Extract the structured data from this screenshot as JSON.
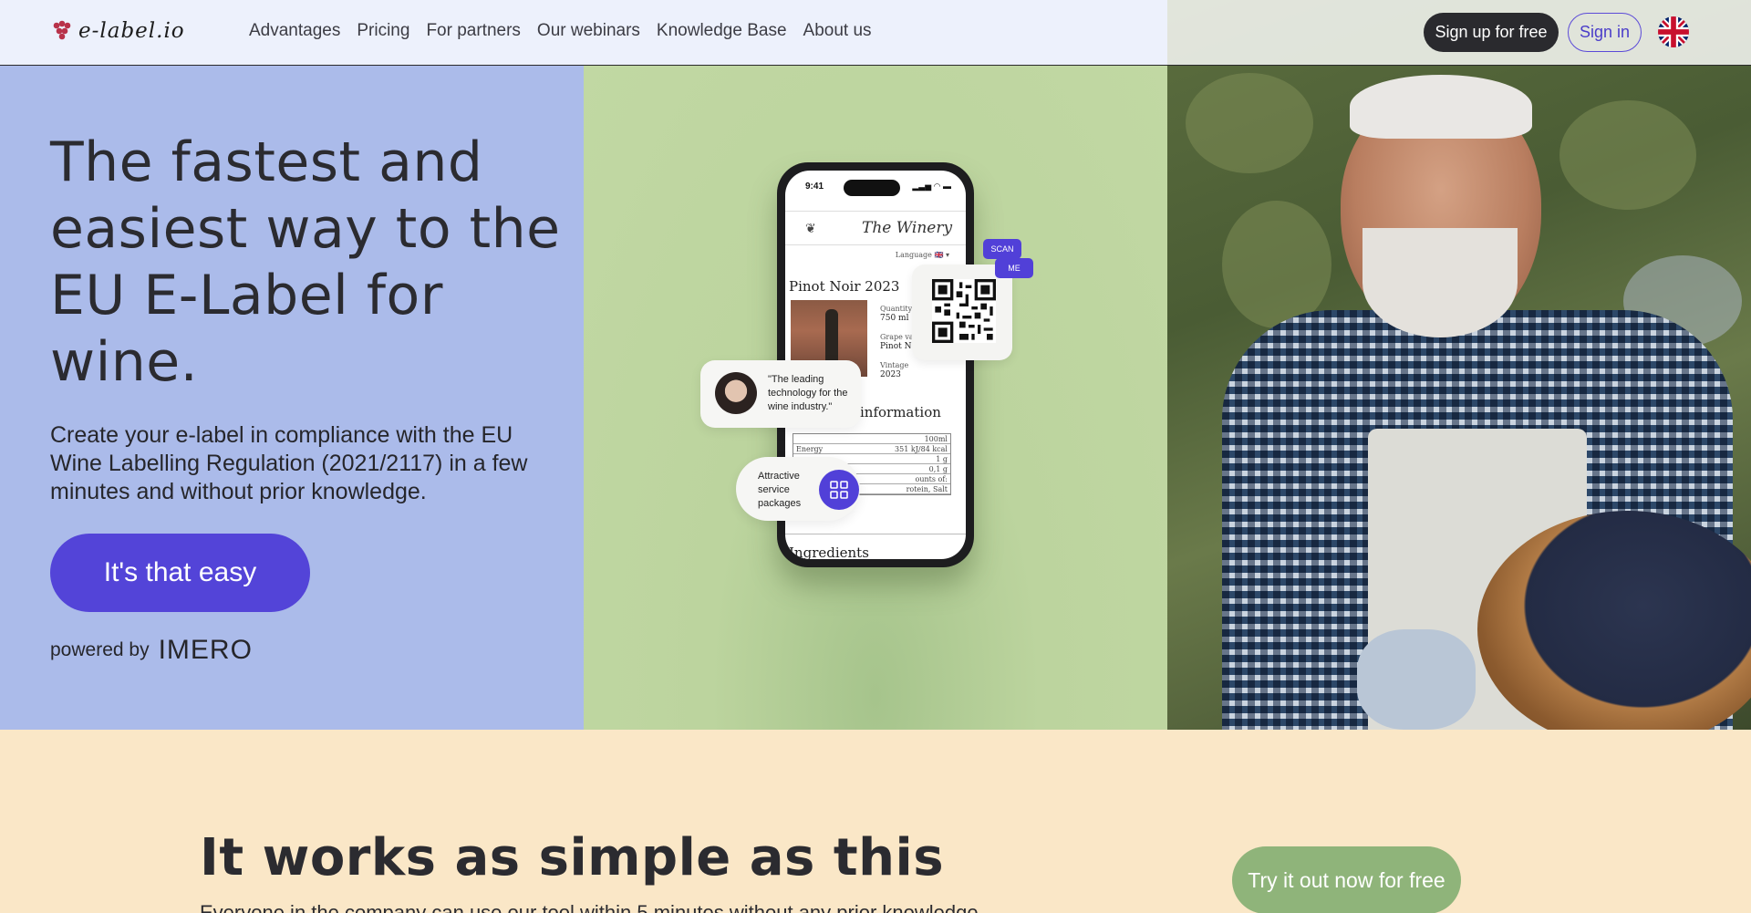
{
  "header": {
    "logo_text": "e-label.io",
    "nav": [
      "Advantages",
      "Pricing",
      "For partners",
      "Our webinars",
      "Knowledge Base",
      "About us"
    ],
    "signup_label": "Sign up for free",
    "signin_label": "Sign in",
    "language_icon": "uk-flag-icon"
  },
  "hero": {
    "title": "The fastest and easiest way to the EU E-Label for wine.",
    "subtitle": "Create your e-label in compliance with the EU Wine Labelling Regulation (2021/2117) in a few minutes and without prior knowledge.",
    "cta_label": "It's that easy",
    "powered_by_label": "powered by",
    "powered_by_brand": "IMERO"
  },
  "phone": {
    "time": "9:41",
    "status": "▂▃▅ ◠ ▬",
    "winery": "The Winery",
    "language_label": "Language",
    "language_flag": "🇬🇧 ▾",
    "product": "Pinot Noir 2023",
    "meta": [
      {
        "label": "Quantity",
        "value": "750 ml"
      },
      {
        "label": "Grape var",
        "value": "Pinot No"
      },
      {
        "label": "Vintage",
        "value": "2023"
      }
    ],
    "info_heading": "information",
    "table_header": "100ml",
    "table_rows": [
      {
        "label": "Energy",
        "value": "351 kJ/84 kcal"
      },
      {
        "label": "",
        "value": "1 g"
      },
      {
        "label": "",
        "value": "0,1 g"
      },
      {
        "label": "",
        "value": "ounts of:"
      },
      {
        "label": "",
        "value": "rotein, Salt"
      }
    ],
    "ingredients_heading": "Ingredients"
  },
  "badges": {
    "scan": "SCAN",
    "me": "ME",
    "quote": "\"The leading technology for the wine industry.\"",
    "service": "Attractive service packages"
  },
  "section2": {
    "title": "It works as simple as this",
    "subtitle": "Everyone in the company can use our tool within 5 minutes without any prior knowledge.",
    "cta_label": "Try it out now for free"
  },
  "colors": {
    "hero_left": "#abbbea",
    "hero_mid": "#c1d8a3",
    "primary": "#5344d8",
    "section2_bg": "#fae7c7",
    "section2_cta": "#8fb47a"
  }
}
